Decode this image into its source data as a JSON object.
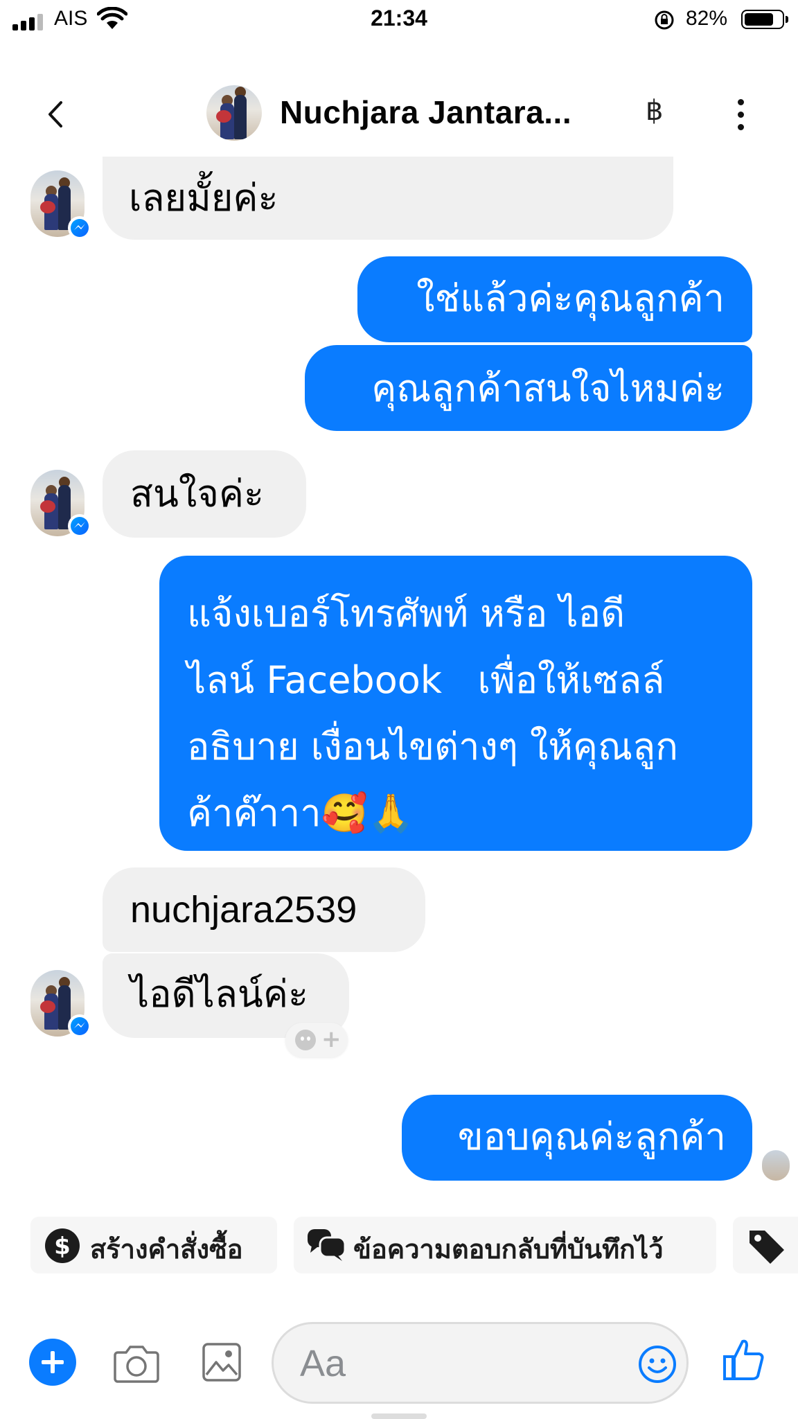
{
  "status_bar": {
    "carrier": "AIS",
    "time": "21:34",
    "battery_percent": "82%",
    "battery_level": 0.82
  },
  "header": {
    "contact_name": "Nuchjara Jantara...",
    "currency_icon": "฿",
    "icons": [
      "back-chevron-icon",
      "baht-icon",
      "more-vertical-icon"
    ]
  },
  "messages": [
    {
      "from": "contact",
      "text": "เลยมั้ยค่ะ"
    },
    {
      "from": "me",
      "text": "ใช่แล้วค่ะคุณลูกค้า"
    },
    {
      "from": "me",
      "text": "คุณลูกค้าสนใจไหมค่ะ"
    },
    {
      "from": "contact",
      "text": "สนใจค่ะ"
    },
    {
      "from": "me",
      "lines": [
        "แจ้งเบอร์โทรศัพท์ หรือ ไอดี",
        "ไลน์ Facebook   เพื่อให้เซลล์",
        "อธิบาย เงื่อนไขต่างๆ ให้คุณลูก",
        "ค้าค๊าาา🥰🙏"
      ]
    },
    {
      "from": "contact",
      "text": "nuchjara2539"
    },
    {
      "from": "contact",
      "text": "ไอดีไลน์ค่ะ"
    },
    {
      "from": "me",
      "text": "ขอบคุณค่ะลูกค้า"
    }
  ],
  "quick_actions": [
    {
      "label": "สร้างคำสั่งซื้อ",
      "icon": "dollar-circle-icon"
    },
    {
      "label": "ข้อความตอบกลับที่บันทึกไว้",
      "icon": "saved-replies-icon"
    },
    {
      "label": "",
      "icon": "tag-icon"
    }
  ],
  "composer": {
    "placeholder": "Aa"
  },
  "colors": {
    "accent": "#0a7cff",
    "incoming_bubble": "#f0f0f0",
    "outgoing_text": "#ffffff"
  }
}
